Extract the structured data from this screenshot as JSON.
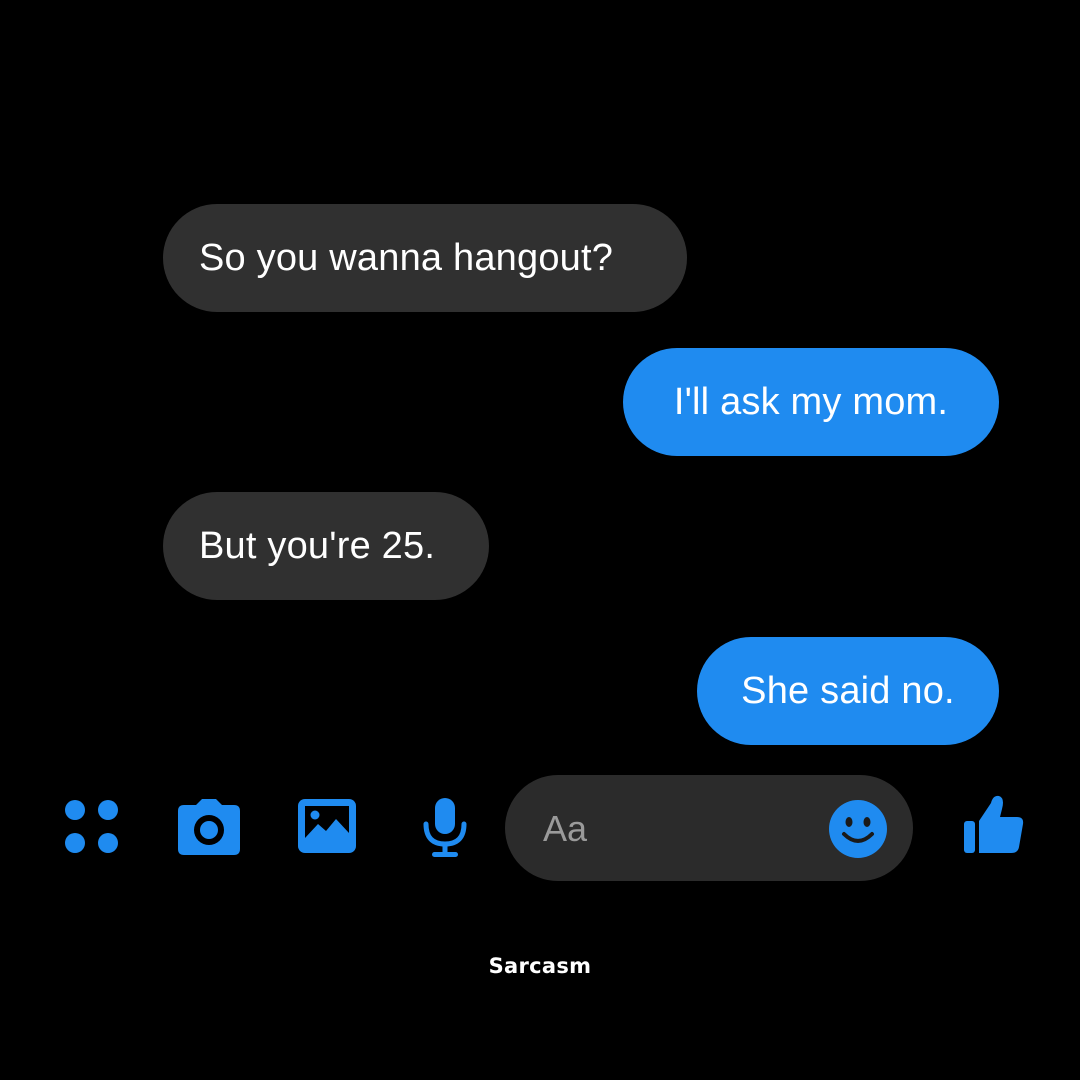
{
  "conversation": {
    "messages": [
      {
        "direction": "received",
        "text": "So you wanna hangout?"
      },
      {
        "direction": "sent",
        "text": "I'll ask my mom."
      },
      {
        "direction": "received",
        "text": "But you're 25."
      },
      {
        "direction": "sent",
        "text": "She said no."
      }
    ]
  },
  "composer": {
    "placeholder": "Aa",
    "icons": [
      "apps-icon",
      "camera-icon",
      "gallery-icon",
      "mic-icon",
      "emoji-icon",
      "like-icon"
    ]
  },
  "caption": "Sarcasm",
  "colors": {
    "background": "#000000",
    "received_bubble": "#303030",
    "sent_bubble": "#1f8bf0",
    "accent": "#1f8bf0",
    "text": "#ffffff",
    "placeholder": "#9a9a9a",
    "input_background": "#2b2b2b"
  }
}
